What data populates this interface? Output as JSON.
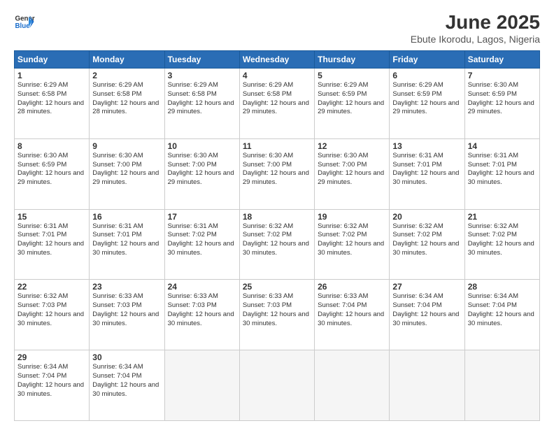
{
  "logo": {
    "line1": "General",
    "line2": "Blue"
  },
  "title": "June 2025",
  "subtitle": "Ebute Ikorodu, Lagos, Nigeria",
  "weekdays": [
    "Sunday",
    "Monday",
    "Tuesday",
    "Wednesday",
    "Thursday",
    "Friday",
    "Saturday"
  ],
  "weeks": [
    [
      {
        "day": 1,
        "sunrise": "6:29 AM",
        "sunset": "6:58 PM",
        "daylight": "12 hours and 28 minutes."
      },
      {
        "day": 2,
        "sunrise": "6:29 AM",
        "sunset": "6:58 PM",
        "daylight": "12 hours and 28 minutes."
      },
      {
        "day": 3,
        "sunrise": "6:29 AM",
        "sunset": "6:58 PM",
        "daylight": "12 hours and 29 minutes."
      },
      {
        "day": 4,
        "sunrise": "6:29 AM",
        "sunset": "6:58 PM",
        "daylight": "12 hours and 29 minutes."
      },
      {
        "day": 5,
        "sunrise": "6:29 AM",
        "sunset": "6:59 PM",
        "daylight": "12 hours and 29 minutes."
      },
      {
        "day": 6,
        "sunrise": "6:29 AM",
        "sunset": "6:59 PM",
        "daylight": "12 hours and 29 minutes."
      },
      {
        "day": 7,
        "sunrise": "6:30 AM",
        "sunset": "6:59 PM",
        "daylight": "12 hours and 29 minutes."
      }
    ],
    [
      {
        "day": 8,
        "sunrise": "6:30 AM",
        "sunset": "6:59 PM",
        "daylight": "12 hours and 29 minutes."
      },
      {
        "day": 9,
        "sunrise": "6:30 AM",
        "sunset": "7:00 PM",
        "daylight": "12 hours and 29 minutes."
      },
      {
        "day": 10,
        "sunrise": "6:30 AM",
        "sunset": "7:00 PM",
        "daylight": "12 hours and 29 minutes."
      },
      {
        "day": 11,
        "sunrise": "6:30 AM",
        "sunset": "7:00 PM",
        "daylight": "12 hours and 29 minutes."
      },
      {
        "day": 12,
        "sunrise": "6:30 AM",
        "sunset": "7:00 PM",
        "daylight": "12 hours and 29 minutes."
      },
      {
        "day": 13,
        "sunrise": "6:31 AM",
        "sunset": "7:01 PM",
        "daylight": "12 hours and 30 minutes."
      },
      {
        "day": 14,
        "sunrise": "6:31 AM",
        "sunset": "7:01 PM",
        "daylight": "12 hours and 30 minutes."
      }
    ],
    [
      {
        "day": 15,
        "sunrise": "6:31 AM",
        "sunset": "7:01 PM",
        "daylight": "12 hours and 30 minutes."
      },
      {
        "day": 16,
        "sunrise": "6:31 AM",
        "sunset": "7:01 PM",
        "daylight": "12 hours and 30 minutes."
      },
      {
        "day": 17,
        "sunrise": "6:31 AM",
        "sunset": "7:02 PM",
        "daylight": "12 hours and 30 minutes."
      },
      {
        "day": 18,
        "sunrise": "6:32 AM",
        "sunset": "7:02 PM",
        "daylight": "12 hours and 30 minutes."
      },
      {
        "day": 19,
        "sunrise": "6:32 AM",
        "sunset": "7:02 PM",
        "daylight": "12 hours and 30 minutes."
      },
      {
        "day": 20,
        "sunrise": "6:32 AM",
        "sunset": "7:02 PM",
        "daylight": "12 hours and 30 minutes."
      },
      {
        "day": 21,
        "sunrise": "6:32 AM",
        "sunset": "7:02 PM",
        "daylight": "12 hours and 30 minutes."
      }
    ],
    [
      {
        "day": 22,
        "sunrise": "6:32 AM",
        "sunset": "7:03 PM",
        "daylight": "12 hours and 30 minutes."
      },
      {
        "day": 23,
        "sunrise": "6:33 AM",
        "sunset": "7:03 PM",
        "daylight": "12 hours and 30 minutes."
      },
      {
        "day": 24,
        "sunrise": "6:33 AM",
        "sunset": "7:03 PM",
        "daylight": "12 hours and 30 minutes."
      },
      {
        "day": 25,
        "sunrise": "6:33 AM",
        "sunset": "7:03 PM",
        "daylight": "12 hours and 30 minutes."
      },
      {
        "day": 26,
        "sunrise": "6:33 AM",
        "sunset": "7:04 PM",
        "daylight": "12 hours and 30 minutes."
      },
      {
        "day": 27,
        "sunrise": "6:34 AM",
        "sunset": "7:04 PM",
        "daylight": "12 hours and 30 minutes."
      },
      {
        "day": 28,
        "sunrise": "6:34 AM",
        "sunset": "7:04 PM",
        "daylight": "12 hours and 30 minutes."
      }
    ],
    [
      {
        "day": 29,
        "sunrise": "6:34 AM",
        "sunset": "7:04 PM",
        "daylight": "12 hours and 30 minutes."
      },
      {
        "day": 30,
        "sunrise": "6:34 AM",
        "sunset": "7:04 PM",
        "daylight": "12 hours and 30 minutes."
      },
      null,
      null,
      null,
      null,
      null
    ]
  ]
}
